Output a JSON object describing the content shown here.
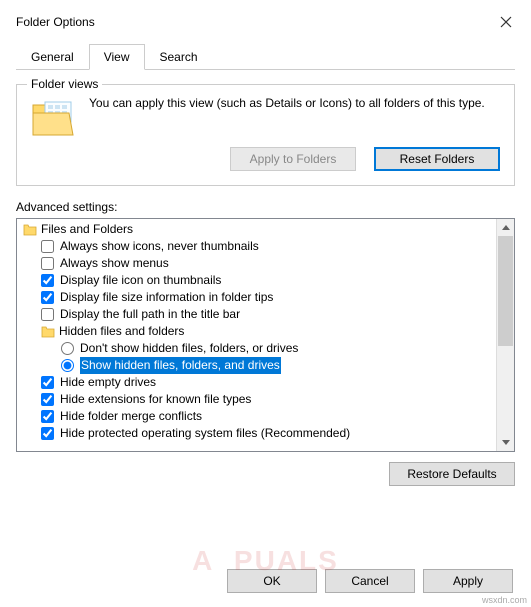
{
  "window": {
    "title": "Folder Options"
  },
  "tabs": {
    "general": "General",
    "view": "View",
    "search": "Search"
  },
  "folder_views": {
    "legend": "Folder views",
    "text": "You can apply this view (such as Details or Icons) to all folders of this type.",
    "apply_btn": "Apply to Folders",
    "reset_btn": "Reset Folders"
  },
  "advanced": {
    "label": "Advanced settings:",
    "root": "Files and Folders",
    "items": {
      "always_icons": "Always show icons, never thumbnails",
      "always_menus": "Always show menus",
      "file_icon_thumb": "Display file icon on thumbnails",
      "file_size_tips": "Display file size information in folder tips",
      "full_path_title": "Display the full path in the title bar",
      "hidden_group": "Hidden files and folders",
      "dont_show_hidden": "Don't show hidden files, folders, or drives",
      "show_hidden": "Show hidden files, folders, and drives",
      "hide_empty": "Hide empty drives",
      "hide_ext": "Hide extensions for known file types",
      "hide_merge": "Hide folder merge conflicts",
      "hide_protected": "Hide protected operating system files (Recommended)"
    },
    "restore_btn": "Restore Defaults"
  },
  "buttons": {
    "ok": "OK",
    "cancel": "Cancel",
    "apply": "Apply"
  },
  "watermark": "wsxdn.com"
}
